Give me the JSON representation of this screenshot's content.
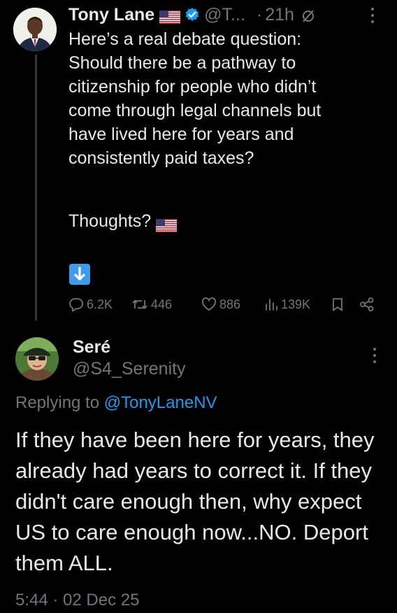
{
  "original_tweet": {
    "author_name": "Tony Lane",
    "handle": "@T...",
    "separator": "·",
    "time": "21h",
    "text_lines": [
      "Here’s a real debate question:",
      "Should there be a pathway to",
      "citizenship for people who didn’t",
      "come through legal channels but",
      "have lived here for years and",
      "consistently paid taxes?"
    ],
    "thoughts": "Thoughts?",
    "icons": {
      "flag": "us-flag-icon",
      "verified": "verified-badge-icon",
      "grok": "grok-icon",
      "more": "more-options-icon",
      "arrow": "down-arrow-emoji-icon"
    },
    "actions": {
      "replies": "6.2K",
      "reposts": "446",
      "likes": "886",
      "views": "139K"
    }
  },
  "reply_tweet": {
    "author_name": "Seré",
    "handle": "@S4_Serenity",
    "replying_prefix": "Replying to",
    "replying_to": "@TonyLaneNV",
    "text": "If they have been here for years, they already had years to correct it. If they didn't care enough then, why expect US to care enough now...NO. Deport them ALL.",
    "timestamp": "5:44 · 02 Dec 25"
  },
  "colors": {
    "background": "#000000",
    "text": "#e7e9ea",
    "muted": "#71767b",
    "link": "#1d9bf0",
    "verified": "#1d9bf0",
    "thread_line": "#333639"
  }
}
